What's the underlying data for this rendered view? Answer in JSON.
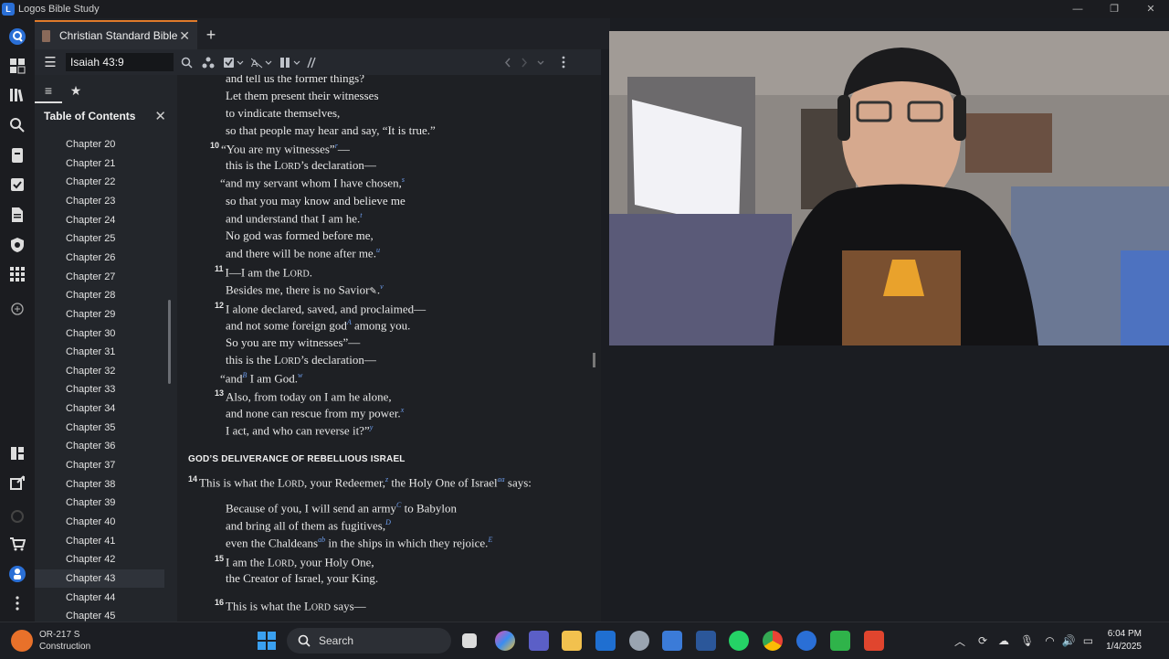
{
  "window": {
    "title": "Logos Bible Study",
    "minimize": "—",
    "maximize": "❐",
    "close": "✕"
  },
  "tabs": [
    {
      "label": "Christian Standard Bible",
      "close": "✕"
    }
  ],
  "new_tab": "+",
  "toolbar": {
    "reference": "Isaiah 43:9"
  },
  "sidebar": {
    "title": "Table of Contents",
    "close": "✕",
    "chapters": [
      "Chapter 20",
      "Chapter 21",
      "Chapter 22",
      "Chapter 23",
      "Chapter 24",
      "Chapter 25",
      "Chapter 26",
      "Chapter 27",
      "Chapter 28",
      "Chapter 29",
      "Chapter 30",
      "Chapter 31",
      "Chapter 32",
      "Chapter 33",
      "Chapter 34",
      "Chapter 35",
      "Chapter 36",
      "Chapter 37",
      "Chapter 38",
      "Chapter 39",
      "Chapter 40",
      "Chapter 41",
      "Chapter 42",
      "Chapter 43",
      "Chapter 44",
      "Chapter 45"
    ],
    "selected": "Chapter 43"
  },
  "text": {
    "l1": "and tell us the former things?",
    "l2": "Let them present their witnesses",
    "l3": "to vindicate themselves,",
    "l4": "so that people may hear and say, “It is true.”",
    "v10": "10",
    "l5": "“You are my witnesses”",
    "l5b": "—",
    "l6a": "this is the L",
    "l6sc": "ORD",
    "l6b": "’s declaration—",
    "l7": "“and my servant whom I have chosen,",
    "f_s": "s",
    "l8": "so that you may know and believe me",
    "l9": "and understand that I am he.",
    "f_t": "t",
    "l10": "No god was formed before me,",
    "l11": "and there will be none after me.",
    "f_u": "u",
    "v11": "11",
    "l12a": "I—I am the L",
    "l12sc": "ORD",
    "l12b": ".",
    "l13": "Besides me, there is no Savior",
    "l13b": ".",
    "f_v": "v",
    "v12": "12",
    "l14": "I alone declared, saved, and proclaimed—",
    "l15a": "and not some foreign god",
    "f_A": "A",
    "l15b": " among you.",
    "l16": "So you are my witnesses”—",
    "l17a": "this is the L",
    "l17sc": "ORD",
    "l17b": "’s declaration—",
    "l18a": "“and",
    "f_B": "B",
    "l18b": " I am God.",
    "f_w": "w",
    "v13": "13",
    "l19": "Also, from today on I am he alone,",
    "l20": "and none can rescue from my power.",
    "f_x": "x",
    "l21": "I act, and who can reverse it?”",
    "f_y": "y",
    "heading": "GOD’S DELIVERANCE OF REBELLIOUS ISRAEL",
    "v14": "14",
    "l22a": "This is what the L",
    "l22sc": "ORD",
    "l22b": ", your Redeemer,",
    "f_z": "z",
    "l22c": " the Holy One of Israel",
    "f_aa": "aa",
    "l22d": " says:",
    "l23a": "Because of you, I will send an army",
    "f_C": "C",
    "l23b": " to Babylon",
    "l24": "and bring all of them as fugitives,",
    "f_D": "D",
    "l25a": "even the Chaldeans",
    "f_ab": "ab",
    "l25b": " in the ships in which they rejoice.",
    "f_E": "E",
    "v15": "15",
    "l26a": "I am the L",
    "l26sc": "ORD",
    "l26b": ", your Holy One,",
    "l27": "the Creator of Israel, your King.",
    "v16": "16",
    "l28a": "This is what the L",
    "l28sc": "ORD",
    "l28b": " says—"
  },
  "taskbar": {
    "weather_temp": "OR-217 S",
    "weather_desc": "Construction",
    "search": "Search",
    "time": "6:04 PM",
    "date": "1/4/2025"
  }
}
